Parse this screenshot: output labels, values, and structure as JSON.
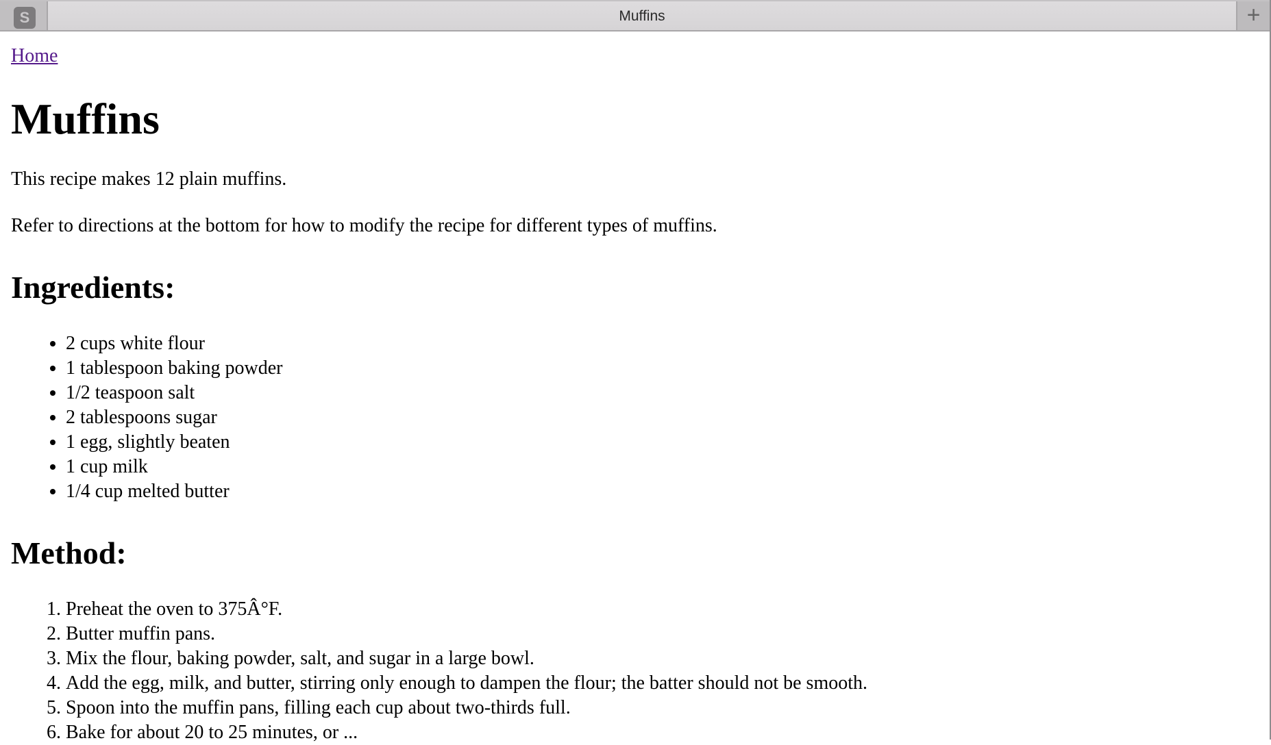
{
  "browser": {
    "tab_icon_letter": "S",
    "tab_title": "Muffins",
    "new_tab_symbol": "+"
  },
  "page": {
    "home_link": "Home",
    "title": "Muffins",
    "intro": [
      "This recipe makes 12 plain muffins.",
      "Refer to directions at the bottom for how to modify the recipe for different types of muffins."
    ],
    "ingredients_heading": "Ingredients:",
    "ingredients": [
      "2 cups white flour",
      "1 tablespoon baking powder",
      "1/2 teaspoon salt",
      "2 tablespoons sugar",
      "1 egg, slightly beaten",
      "1 cup milk",
      "1/4 cup melted butter"
    ],
    "method_heading": "Method:",
    "method": [
      "Preheat the oven to 375Â°F.",
      "Butter muffin pans.",
      "Mix the flour, baking powder, salt, and sugar in a large bowl.",
      "Add the egg, milk, and butter, stirring only enough to dampen the flour; the batter should not be smooth.",
      "Spoon into the muffin pans, filling each cup about two-thirds full.",
      "Bake for about 20 to 25 minutes, or ..."
    ]
  }
}
